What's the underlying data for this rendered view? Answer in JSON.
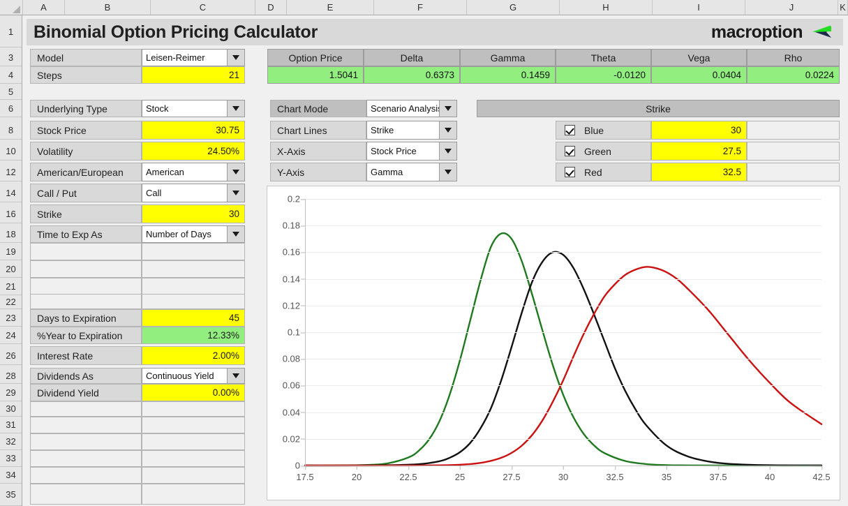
{
  "spreadsheet": {
    "columns": [
      "A",
      "B",
      "C",
      "D",
      "E",
      "F",
      "G",
      "H",
      "I",
      "J",
      "K"
    ],
    "rows": [
      "1",
      "3",
      "4",
      "5",
      "6",
      "8",
      "10",
      "12",
      "14",
      "16",
      "18",
      "19",
      "20",
      "21",
      "22",
      "23",
      "24",
      "26",
      "28",
      "29",
      "30",
      "31",
      "32",
      "33",
      "34",
      "35"
    ]
  },
  "header": {
    "title": "Binomial Option Pricing Calculator",
    "logo_text": "macroption",
    "logo_green": "#22dd22",
    "logo_navy": "#1b2a4a"
  },
  "model_panel": {
    "rows": [
      {
        "label": "Model",
        "type": "dropdown",
        "value": "Leisen-Reimer"
      },
      {
        "label": "Steps",
        "type": "input",
        "value": "21"
      }
    ]
  },
  "inputs": {
    "rows": [
      {
        "label": "Underlying Type",
        "type": "dropdown",
        "value": "Stock"
      },
      {
        "label": "Stock Price",
        "type": "input",
        "value": "30.75"
      },
      {
        "label": "Volatility",
        "type": "input",
        "value": "24.50%"
      },
      {
        "label": "American/European",
        "type": "dropdown",
        "value": "American"
      },
      {
        "label": "Call / Put",
        "type": "dropdown",
        "value": "Call"
      },
      {
        "label": "Strike",
        "type": "input",
        "value": "30"
      },
      {
        "label": "Time to Exp As",
        "type": "dropdown",
        "value": "Number of Days"
      },
      {
        "label": "",
        "type": "blank",
        "value": ""
      },
      {
        "label": "",
        "type": "blank",
        "value": ""
      },
      {
        "label": "",
        "type": "blank",
        "value": ""
      },
      {
        "label": "",
        "type": "blank",
        "value": ""
      },
      {
        "label": "Days to Expiration",
        "type": "input",
        "value": "45"
      },
      {
        "label": "%Year to Expiration",
        "type": "calc",
        "value": "12.33%"
      },
      {
        "label": "Interest Rate",
        "type": "input",
        "value": "2.00%"
      },
      {
        "label": "Dividends As",
        "type": "dropdown",
        "value": "Continuous Yield"
      },
      {
        "label": "Dividend Yield",
        "type": "input",
        "value": "0.00%"
      },
      {
        "label": "",
        "type": "blank",
        "value": ""
      },
      {
        "label": "",
        "type": "blank",
        "value": ""
      },
      {
        "label": "",
        "type": "blank",
        "value": ""
      },
      {
        "label": "",
        "type": "blank",
        "value": ""
      },
      {
        "label": "",
        "type": "blank",
        "value": ""
      },
      {
        "label": "",
        "type": "blank",
        "value": ""
      }
    ]
  },
  "results": {
    "headers": [
      "Option Price",
      "Delta",
      "Gamma",
      "Theta",
      "Vega",
      "Rho"
    ],
    "values": [
      "1.5041",
      "0.6373",
      "0.1459",
      "-0.0120",
      "0.0404",
      "0.0224"
    ]
  },
  "chart_controls": {
    "rows": [
      {
        "label": "Chart Mode",
        "value": "Scenario Analysis"
      },
      {
        "label": "Chart Lines",
        "value": "Strike"
      },
      {
        "label": "X-Axis",
        "value": "Stock Price"
      },
      {
        "label": "Y-Axis",
        "value": "Gamma"
      }
    ]
  },
  "scenarios": {
    "title": "Strike",
    "rows": [
      {
        "name": "Blue",
        "checked": true,
        "value": "30"
      },
      {
        "name": "Green",
        "checked": true,
        "value": "27.5"
      },
      {
        "name": "Red",
        "checked": true,
        "value": "32.5"
      }
    ]
  },
  "chart_data": {
    "type": "line",
    "title": "",
    "xlabel": "Stock Price",
    "ylabel": "Gamma",
    "xlim": [
      17.5,
      42.5
    ],
    "ylim": [
      0,
      0.2
    ],
    "xticks": [
      "17.5",
      "20",
      "22.5",
      "25",
      "27.5",
      "30",
      "32.5",
      "35",
      "37.5",
      "40",
      "42.5"
    ],
    "yticks": [
      "0",
      "0.02",
      "0.04",
      "0.06",
      "0.08",
      "0.1",
      "0.12",
      "0.14",
      "0.16",
      "0.18",
      "0.2"
    ],
    "grid": true,
    "legend": "none",
    "series": [
      {
        "name": "Green",
        "color": "#1f7a1f",
        "strike": 27.5,
        "peak_x": 27.0,
        "peak_y": 0.174,
        "x": [
          17.5,
          18.5,
          19.5,
          20.5,
          21.5,
          22.5,
          23.0,
          23.5,
          24.0,
          24.5,
          25.0,
          25.5,
          26.0,
          26.5,
          27.0,
          27.5,
          28.0,
          28.5,
          29.0,
          29.5,
          30.0,
          30.5,
          31.0,
          31.5,
          32.0,
          33.0,
          34.0,
          35.0,
          36.0,
          37.5,
          40.0,
          42.5
        ],
        "y": [
          0.0,
          0.0,
          0.0001,
          0.0004,
          0.0016,
          0.006,
          0.011,
          0.0195,
          0.033,
          0.053,
          0.079,
          0.109,
          0.139,
          0.164,
          0.174,
          0.17,
          0.153,
          0.128,
          0.101,
          0.075,
          0.053,
          0.036,
          0.0235,
          0.015,
          0.0093,
          0.0034,
          0.0011,
          0.0003,
          0.0001,
          0.0,
          0.0,
          0.0
        ]
      },
      {
        "name": "Blue",
        "color": "#111111",
        "strike": 30,
        "peak_x": 29.7,
        "peak_y": 0.16,
        "x": [
          17.5,
          19.5,
          21.5,
          23.0,
          24.0,
          24.5,
          25.0,
          25.5,
          26.0,
          26.5,
          27.0,
          27.5,
          28.0,
          28.5,
          29.0,
          29.5,
          30.0,
          30.5,
          31.0,
          31.5,
          32.0,
          32.5,
          33.0,
          33.5,
          34.0,
          35.0,
          36.0,
          37.0,
          38.0,
          40.0,
          42.5
        ],
        "y": [
          0.0,
          0.0,
          0.0002,
          0.001,
          0.0032,
          0.0058,
          0.01,
          0.017,
          0.028,
          0.043,
          0.064,
          0.089,
          0.115,
          0.138,
          0.153,
          0.16,
          0.158,
          0.148,
          0.132,
          0.113,
          0.093,
          0.073,
          0.056,
          0.042,
          0.0305,
          0.015,
          0.007,
          0.0031,
          0.0013,
          0.0002,
          0.0
        ]
      },
      {
        "name": "Red",
        "color": "#cc1111",
        "strike": 32.5,
        "peak_x": 32.3,
        "peak_y": 0.149,
        "x": [
          17.5,
          20.0,
          22.5,
          24.5,
          25.5,
          26.0,
          26.5,
          27.0,
          27.5,
          28.0,
          28.5,
          29.0,
          29.5,
          30.0,
          30.5,
          31.0,
          31.5,
          32.0,
          32.5,
          33.0,
          33.5,
          34.0,
          34.5,
          35.0,
          35.5,
          36.0,
          37.0,
          38.0,
          39.0,
          40.0,
          41.0,
          42.5
        ],
        "y": [
          0.0,
          0.0,
          0.0,
          0.0003,
          0.0011,
          0.002,
          0.0035,
          0.0058,
          0.0095,
          0.015,
          0.023,
          0.034,
          0.048,
          0.064,
          0.082,
          0.099,
          0.114,
          0.127,
          0.136,
          0.143,
          0.147,
          0.149,
          0.148,
          0.145,
          0.14,
          0.133,
          0.117,
          0.098,
          0.079,
          0.062,
          0.047,
          0.031
        ]
      }
    ]
  }
}
